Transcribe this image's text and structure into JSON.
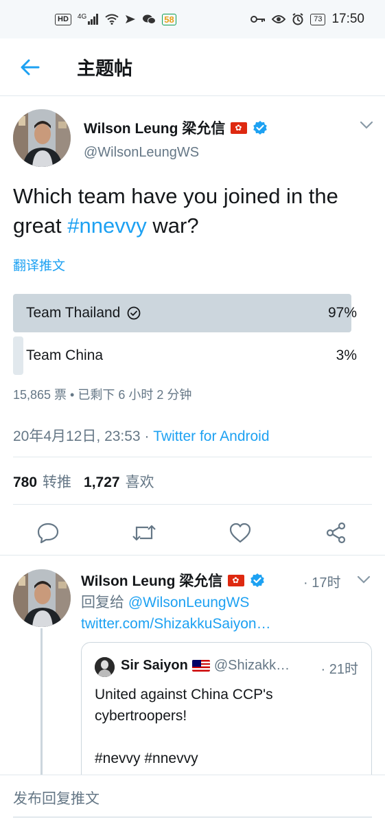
{
  "status_bar": {
    "hd": "HD",
    "network": "4G",
    "app_badge": "58",
    "battery": "73",
    "time": "17:50"
  },
  "header": {
    "title": "主题帖"
  },
  "tweet": {
    "author_name": "Wilson Leung 梁允信",
    "handle": "@WilsonLeungWS",
    "text_before": "Which team have you joined in the great ",
    "hashtag": "#nnevvy",
    "text_after": " war?",
    "translate": "翻译推文",
    "poll": {
      "options": [
        {
          "label": "Team Thailand",
          "percent": "97%",
          "fraction": 0.97,
          "winner": true
        },
        {
          "label": "Team China",
          "percent": "3%",
          "fraction": 0.03,
          "winner": false
        }
      ],
      "meta": "15,865 票 • 已剩下 6 小时 2 分钟"
    },
    "timestamp": "20年4月12日, 23:53 · ",
    "source": "Twitter for Android",
    "retweets_count": "780",
    "retweets_label": "转推",
    "likes_count": "1,727",
    "likes_label": "喜欢"
  },
  "reply": {
    "author_name": "Wilson Leung 梁允信",
    "time": "· 17时",
    "reply_to_prefix": "回复给 ",
    "reply_to_handle": "@WilsonLeungWS",
    "link": "twitter.com/ShizakkuSaiyon…",
    "quote": {
      "author_name": "Sir Saiyon",
      "handle": "@Shizakk…",
      "time": "· 21时",
      "text": "United against China CCP's cybertroopers!\n\n#nevvy #nnevvy"
    }
  },
  "composer": {
    "placeholder": "发布回复推文"
  },
  "colors": {
    "accent": "#1da1f2",
    "secondary_text": "#657786",
    "poll_fill": "#ccd6dd",
    "divider": "#e1e8ed"
  }
}
